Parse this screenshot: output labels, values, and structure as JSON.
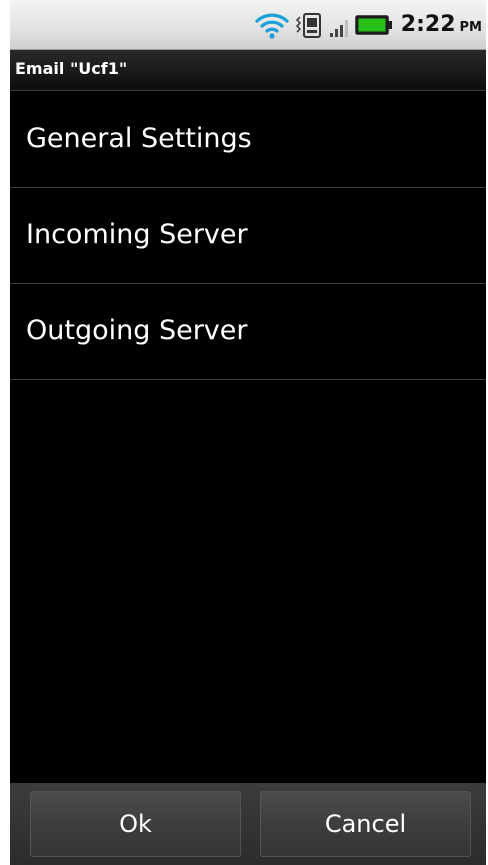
{
  "status_bar": {
    "icons": [
      "wifi-icon",
      "vibrate-icon",
      "signal-icon",
      "battery-icon"
    ],
    "time": "2:22",
    "ampm": "PM",
    "battery_color": "#27c017",
    "wifi_color": "#1a9fd6"
  },
  "header": {
    "title": "Email \"Ucf1\""
  },
  "settings": {
    "items": [
      {
        "label": "General Settings"
      },
      {
        "label": "Incoming Server"
      },
      {
        "label": "Outgoing Server"
      }
    ]
  },
  "buttons": {
    "ok_label": "Ok",
    "cancel_label": "Cancel"
  }
}
